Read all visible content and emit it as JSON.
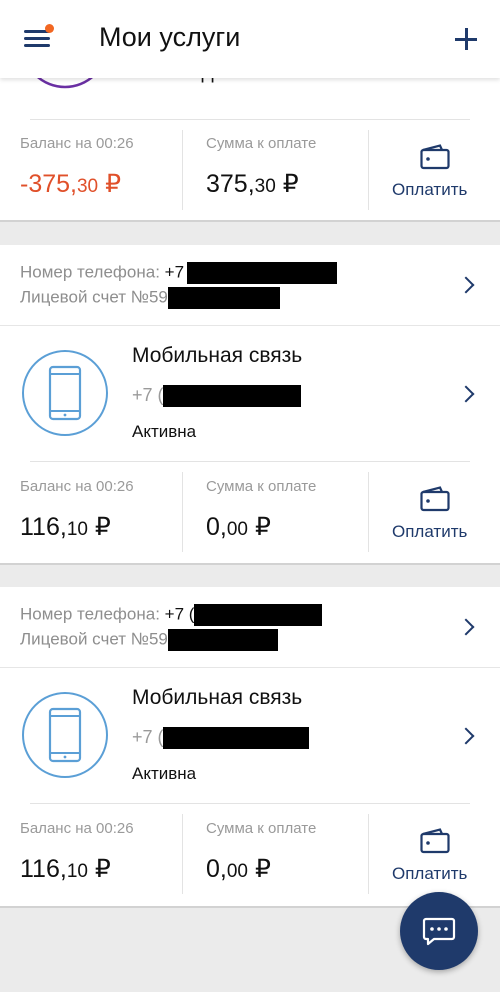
{
  "header": {
    "title": "Мои услуги"
  },
  "tv_card": {
    "service_name": "Телевидение",
    "balance_label": "Баланс на 00:26",
    "balance_int": "-375,",
    "balance_frac": "30",
    "balance_currency": "₽",
    "due_label": "Сумма к оплате",
    "due_int": "375,",
    "due_frac": "30",
    "due_currency": "₽",
    "pay_label": "Оплатить"
  },
  "accounts": [
    {
      "phone_label": "Номер телефона: ",
      "phone_prefix": "+7",
      "account_label": "Лицевой счет №59",
      "service_name": "Мобильная связь",
      "service_phone": "+7 (",
      "status": "Активна",
      "balance_label": "Баланс на 00:26",
      "balance_int": "116,",
      "balance_frac": "10",
      "balance_currency": "₽",
      "due_label": "Сумма к оплате",
      "due_int": "0,",
      "due_frac": "00",
      "due_currency": "₽",
      "pay_label": "Оплатить"
    },
    {
      "phone_label": "Номер телефона: ",
      "phone_prefix": "+7 (",
      "account_label": "Лицевой счет №59",
      "service_name": "Мобильная связь",
      "service_phone": "+7 (",
      "status": "Активна",
      "balance_label": "Баланс на 00:26",
      "balance_int": "116,",
      "balance_frac": "10",
      "balance_currency": "₽",
      "due_label": "Сумма к оплате",
      "due_int": "0,",
      "due_frac": "00",
      "due_currency": "₽",
      "pay_label": "Оплатить"
    }
  ],
  "colors": {
    "accent": "#1f3a6b",
    "negative": "#e0502a",
    "badge": "#f26722",
    "icon_blue": "#5b9fd6",
    "tv_purple": "#6a2fa3"
  },
  "icons": {
    "menu": "menu-icon",
    "add": "plus-icon",
    "wallet": "wallet-icon",
    "chevron": "chevron-right-icon",
    "phone": "smartphone-icon",
    "tv": "tv-icon",
    "chat": "chat-icon"
  }
}
